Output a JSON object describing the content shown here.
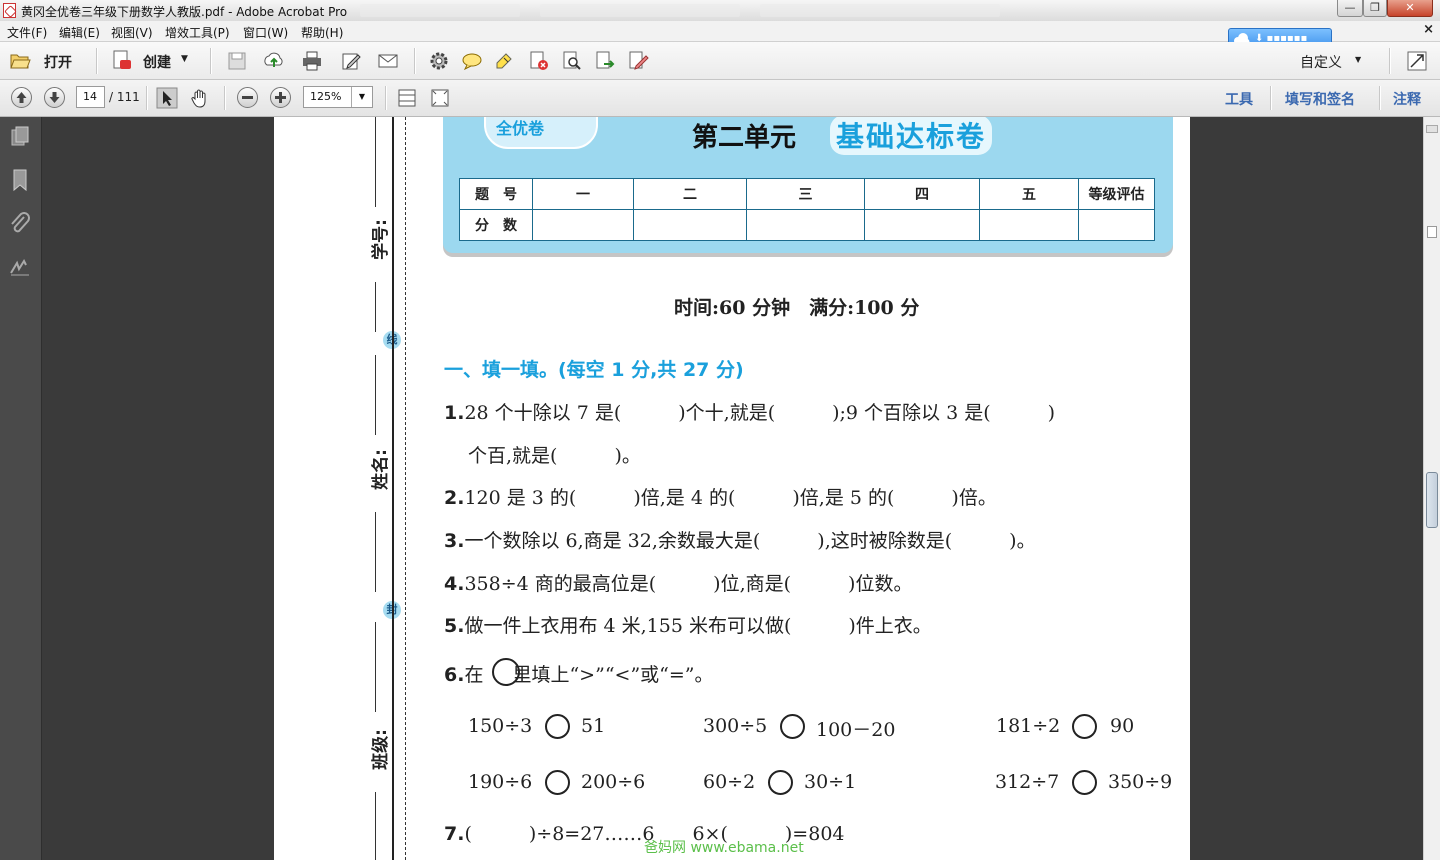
{
  "window": {
    "title": "黄冈全优卷三年级下册数学人教版.pdf - Adobe Acrobat Pro",
    "controls": [
      "—",
      "❐",
      "✕"
    ]
  },
  "menubar": {
    "items": [
      "文件(F)",
      "编辑(E)",
      "视图(V)",
      "增效工具(P)",
      "窗口(W)",
      "帮助(H)"
    ],
    "close": "×"
  },
  "toolbar": {
    "open_label": "打开",
    "create_label": "创建",
    "customize_label": "自定义",
    "icons": [
      "save-icon",
      "upload-icon",
      "print-icon",
      "edit-icon",
      "email-icon",
      "gear-icon",
      "comment-icon",
      "highlight-icon",
      "delete-icon",
      "search-icon",
      "export-icon",
      "sign-icon"
    ]
  },
  "navbar": {
    "page_current": "14",
    "page_total": "/ 111",
    "zoom": "125%",
    "tools_label": "工具",
    "fill_sign_label": "填写和签名",
    "comment_label": "注释"
  },
  "document": {
    "margin": {
      "student_id": "学号:",
      "name": "姓名:",
      "class": "班级:",
      "line_mark": "线",
      "seal_mark": "封"
    },
    "badge": "全优卷",
    "unit_title": "第二单元",
    "unit_subtitle": "基础达标卷",
    "score_table": {
      "row1": [
        "题　号",
        "一",
        "二",
        "三",
        "四",
        "五",
        "等级评估"
      ],
      "row2": [
        "分　数",
        "",
        "",
        "",
        "",
        "",
        ""
      ]
    },
    "time_info": "时间:60 分钟　满分:100 分",
    "section1_title": "一、填一填。(每空 1 分,共 27 分)",
    "questions": [
      {
        "num": "1.",
        "text": "28 个十除以 7 是(　　　)个十,就是(　　　);9 个百除以 3 是(　　　)"
      },
      {
        "num": "",
        "text": "个百,就是(　　　)。"
      },
      {
        "num": "2.",
        "text": "120 是 3 的(　　　)倍,是 4 的(　　　)倍,是 5 的(　　　)倍。"
      },
      {
        "num": "3.",
        "text": "一个数除以 6,商是 32,余数最大是(　　　),这时被除数是(　　　)。"
      },
      {
        "num": "4.",
        "text": "358÷4 商的最高位是(　　　)位,商是(　　　)位数。"
      },
      {
        "num": "5.",
        "text": "做一件上衣用布 4 米,155 米布可以做(　　　)件上衣。"
      },
      {
        "num": "6.",
        "text_before": "在",
        "text_after": "里填上“>”“<”或“=”。"
      }
    ],
    "comparisons": [
      {
        "left": "150÷3",
        "right": "51"
      },
      {
        "left": "300÷5",
        "right": "100－20"
      },
      {
        "left": "181÷2",
        "right": "90"
      },
      {
        "left": "190÷6",
        "right": "200÷6"
      },
      {
        "left": "60÷2",
        "right": "30÷1"
      },
      {
        "left": "312÷7",
        "right": "350÷9"
      }
    ],
    "q7": {
      "num": "7.",
      "text": "(　　　)÷8=27……6　　6×(　　　)=804"
    },
    "watermark": "爸妈网 www.ebama.net"
  }
}
